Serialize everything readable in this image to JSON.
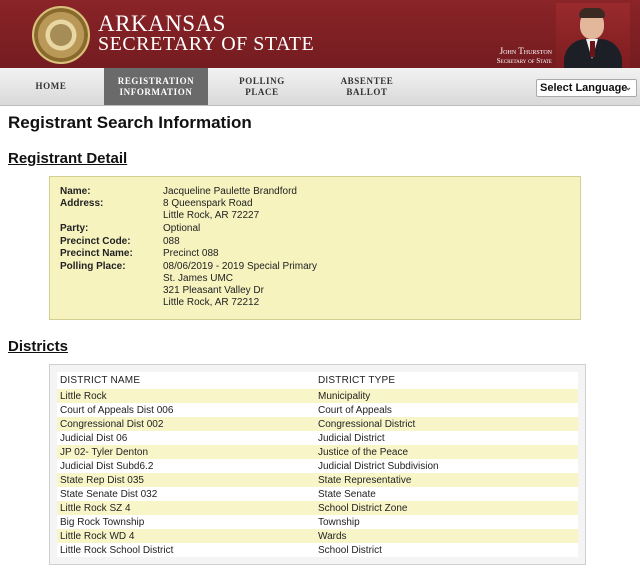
{
  "header": {
    "brand_line1": "ARKANSAS",
    "brand_line2": "SECRETARY OF STATE",
    "official_name": "John Thurston",
    "official_title": "Secretary of State"
  },
  "nav": {
    "items": [
      {
        "line1": "HOME",
        "line2": ""
      },
      {
        "line1": "REGISTRATION",
        "line2": "INFORMATION"
      },
      {
        "line1": "POLLING",
        "line2": "PLACE"
      },
      {
        "line1": "ABSENTEE",
        "line2": "BALLOT"
      }
    ],
    "active_index": 1,
    "language_select": "Select Language"
  },
  "page": {
    "title": "Registrant Search Information",
    "detail_section_title": "Registrant Detail",
    "districts_section_title": "Districts"
  },
  "registrant": {
    "labels": {
      "name": "Name:",
      "address": "Address:",
      "party": "Party:",
      "precinct_code": "Precinct Code:",
      "precinct_name": "Precinct Name:",
      "polling_place": "Polling Place:"
    },
    "name": "Jacqueline Paulette Brandford",
    "address_line1": "8 Queenspark Road",
    "address_line2": "Little Rock, AR 72227",
    "party": "Optional",
    "precinct_code": "088",
    "precinct_name": "Precinct 088",
    "polling_line1": "08/06/2019 - 2019 Special Primary",
    "polling_line2": "St. James UMC",
    "polling_line3": "321 Pleasant Valley Dr",
    "polling_line4": "Little Rock, AR 72212"
  },
  "districts": {
    "headers": [
      "DISTRICT NAME",
      "DISTRICT TYPE"
    ],
    "rows": [
      [
        "Little Rock",
        "Municipality"
      ],
      [
        "Court of Appeals Dist 006",
        "Court of Appeals"
      ],
      [
        "Congressional Dist 002",
        "Congressional District"
      ],
      [
        "Judicial Dist 06",
        "Judicial District"
      ],
      [
        "JP 02- Tyler Denton",
        "Justice of the Peace"
      ],
      [
        "Judicial Dist Subd6.2",
        "Judicial District Subdivision"
      ],
      [
        "State Rep Dist 035",
        "State Representative"
      ],
      [
        "State Senate Dist 032",
        "State Senate"
      ],
      [
        "Little Rock SZ 4",
        "School District Zone"
      ],
      [
        "Big Rock Township",
        "Township"
      ],
      [
        "Little Rock WD 4",
        "Wards"
      ],
      [
        "Little Rock School District",
        "School District"
      ]
    ]
  },
  "colors": {
    "header_bg": "#7a1f22",
    "nav_active_bg": "#6a6a6a",
    "detail_box_bg": "#f6f3bf",
    "row_alt_bg": "#f8f6c8"
  }
}
